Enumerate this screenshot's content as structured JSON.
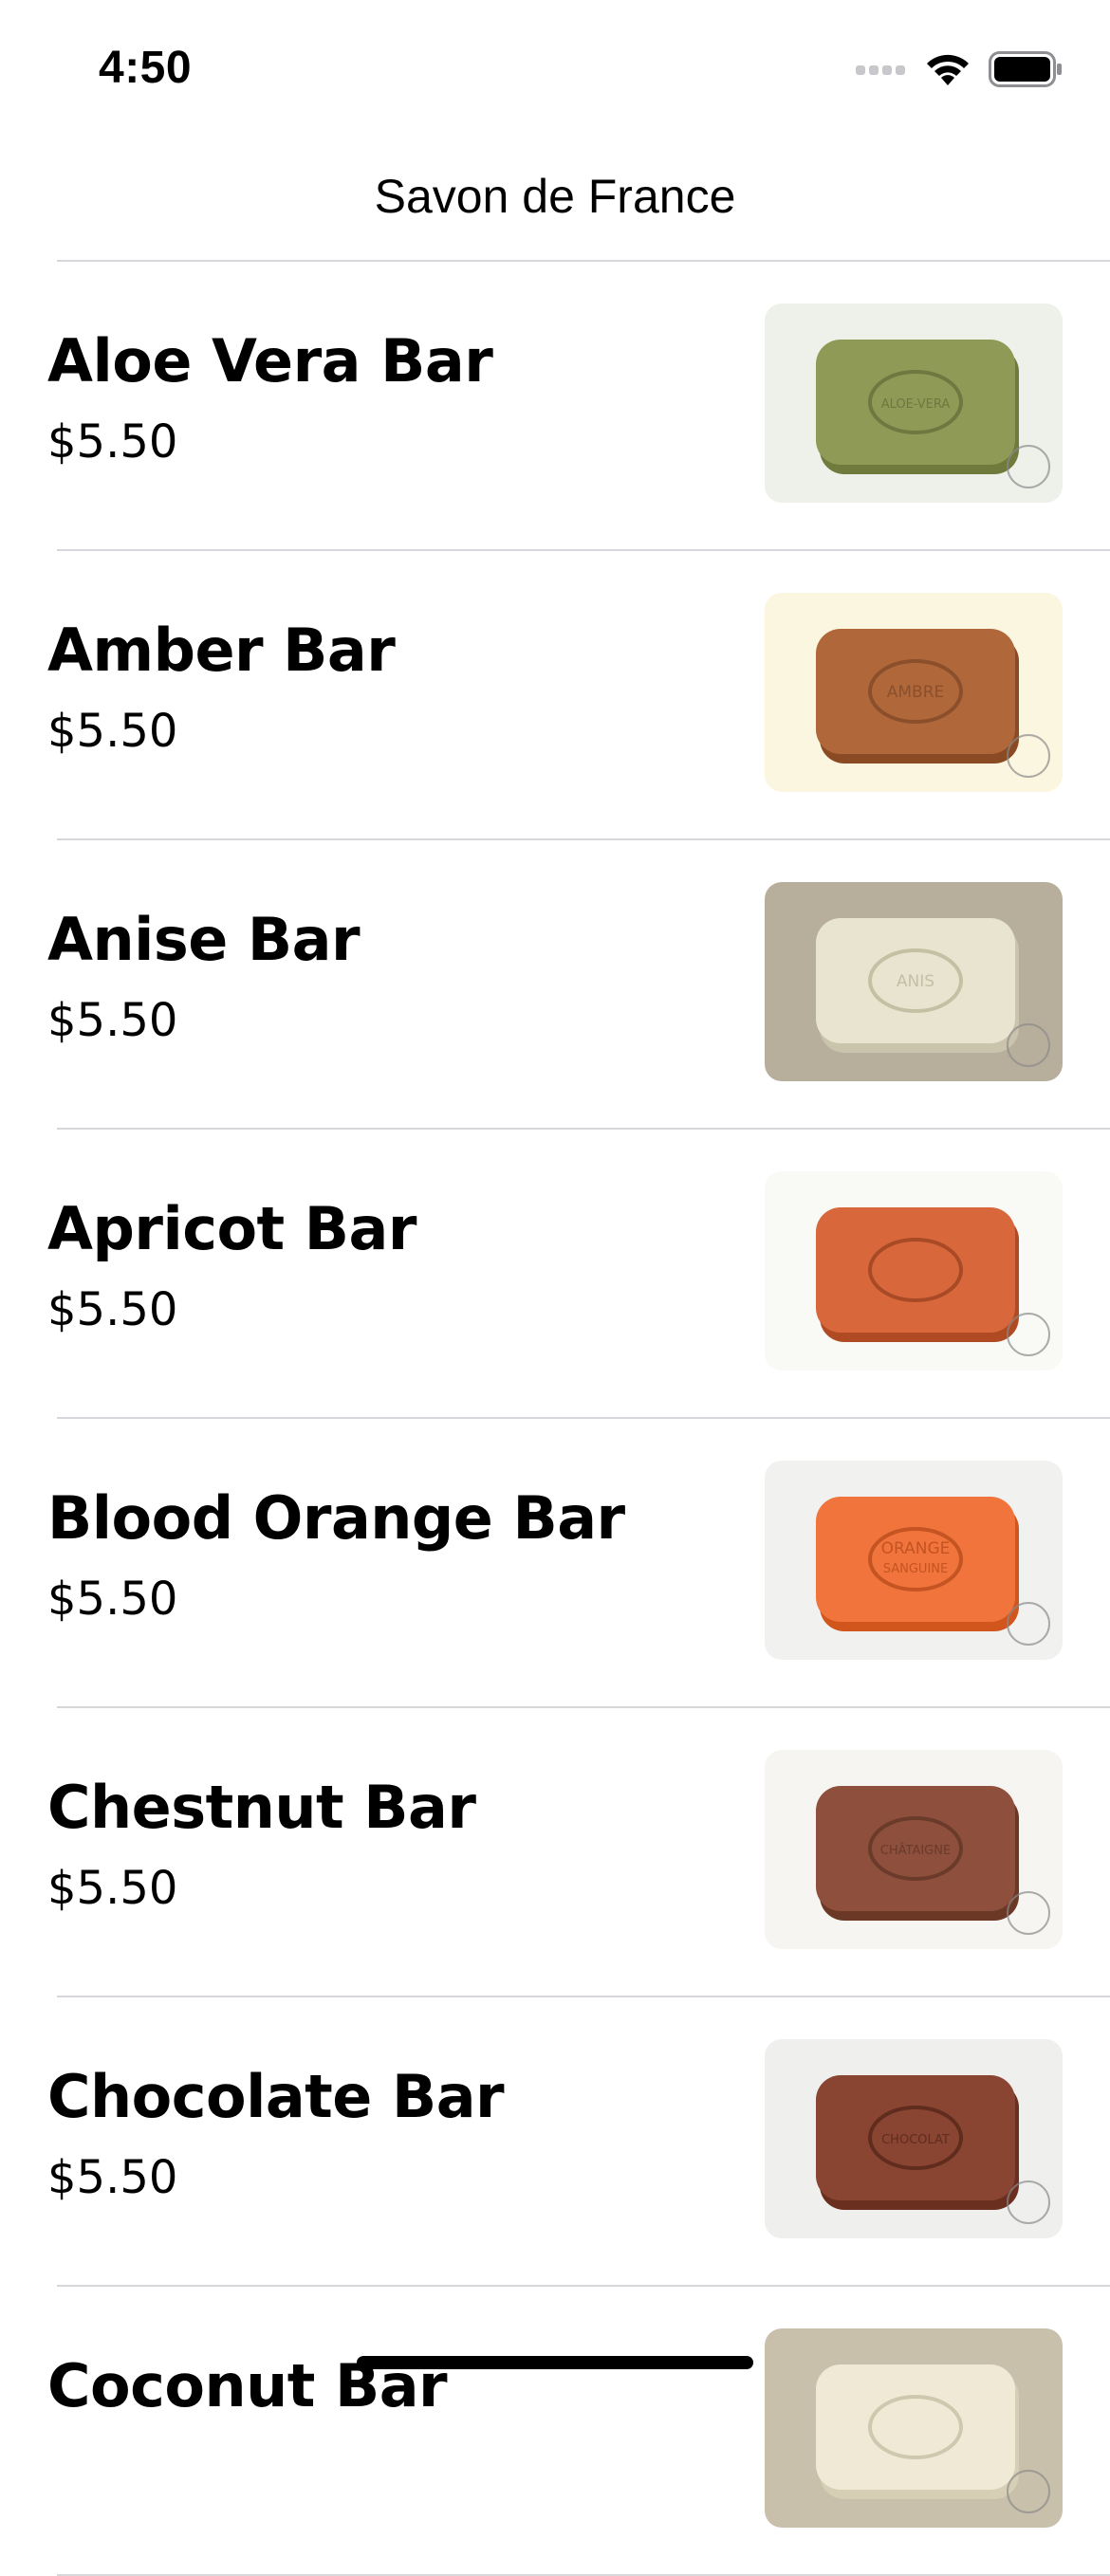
{
  "status_bar": {
    "time": "4:50"
  },
  "nav": {
    "title": "Savon de France"
  },
  "products": [
    {
      "name": "Aloe Vera Bar",
      "price": "$5.50",
      "stamp": "ALOE-VERA",
      "soap_color": "#8e9a55",
      "soap_shadow": "#6f7a3c",
      "bg": "#eef0ea",
      "stamp_color": "#6e7840"
    },
    {
      "name": "Amber Bar",
      "price": "$5.50",
      "stamp": "AMBRE",
      "soap_color": "#b0683a",
      "soap_shadow": "#8a4b24",
      "bg": "#fbf6df",
      "stamp_color": "#8b4f2b"
    },
    {
      "name": "Anise Bar",
      "price": "$5.50",
      "stamp": "ANIS",
      "soap_color": "#e8e4d0",
      "soap_shadow": "#c9c4ab",
      "bg": "#b7ae9c",
      "stamp_color": "#c5bfa4"
    },
    {
      "name": "Apricot Bar",
      "price": "$5.50",
      "stamp": "",
      "soap_color": "#d8683c",
      "soap_shadow": "#b04a22",
      "bg": "#f9f9f6",
      "stamp_color": "#a84a25"
    },
    {
      "name": "Blood Orange Bar",
      "price": "$5.50",
      "stamp": "ORANGE SANGUINE",
      "soap_color": "#f0743c",
      "soap_shadow": "#d0561e",
      "bg": "#f1f2f0",
      "stamp_color": "#c45422"
    },
    {
      "name": "Chestnut Bar",
      "price": "$5.50",
      "stamp": "CHÂTAIGNE",
      "soap_color": "#8e503c",
      "soap_shadow": "#6c3826",
      "bg": "#f6f5f1",
      "stamp_color": "#6a3a2a"
    },
    {
      "name": "Chocolate Bar",
      "price": "$5.50",
      "stamp": "CHOCOLAT",
      "soap_color": "#8a4532",
      "soap_shadow": "#6a2f1e",
      "bg": "#eff0ee",
      "stamp_color": "#5f2c1d"
    },
    {
      "name": "Coconut Bar",
      "price": "",
      "stamp": "",
      "soap_color": "#efe9d6",
      "soap_shadow": "#d6cfb5",
      "bg": "#c9c0ac",
      "stamp_color": "#cfc7ae"
    }
  ]
}
